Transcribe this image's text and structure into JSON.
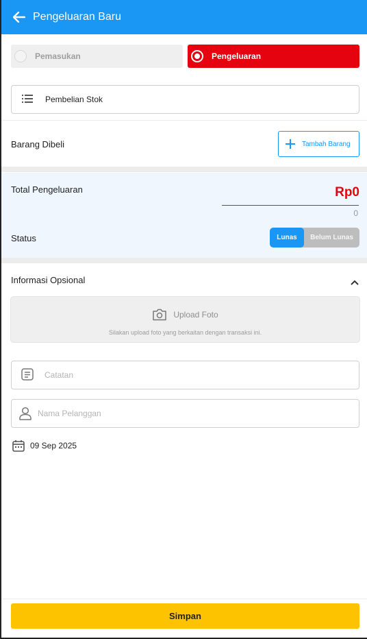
{
  "appbar": {
    "title": "Pengeluaran Baru",
    "back_icon": "arrow-left-icon"
  },
  "type_selector": {
    "income_label": "Pemasukan",
    "expense_label": "Pengeluaran",
    "selected": "Pengeluaran",
    "expense_color": "#e5030f"
  },
  "category": {
    "icon": "list-icon",
    "value": "Pembelian Stok"
  },
  "items": {
    "label": "Barang Dibeli",
    "add_button_label": "Tambah Barang",
    "add_icon": "plus-icon"
  },
  "total": {
    "label": "Total Pengeluaran",
    "value": "Rp0",
    "sub_value": "0",
    "status_label": "Status",
    "status_options": [
      "Lunas",
      "Belum Lunas"
    ],
    "status_selected": "Lunas"
  },
  "optional": {
    "label": "Informasi Opsional",
    "toggle_icon": "chevron-up-icon",
    "upload_label": "Upload Foto",
    "upload_hint": "Silakan upload foto yang berkaitan dengan transaksi ini.",
    "upload_icon": "camera-icon"
  },
  "notes": {
    "placeholder": "Catatan",
    "icon": "note-icon"
  },
  "customer": {
    "placeholder": "Nama Pelanggan",
    "icon": "person-icon"
  },
  "date": {
    "value": "09 Sep 2025",
    "icon": "calendar-icon"
  },
  "footer": {
    "save_label": "Simpan"
  },
  "colors": {
    "primary": "#1a96f5",
    "danger": "#e5030f",
    "accent": "#fec300"
  }
}
